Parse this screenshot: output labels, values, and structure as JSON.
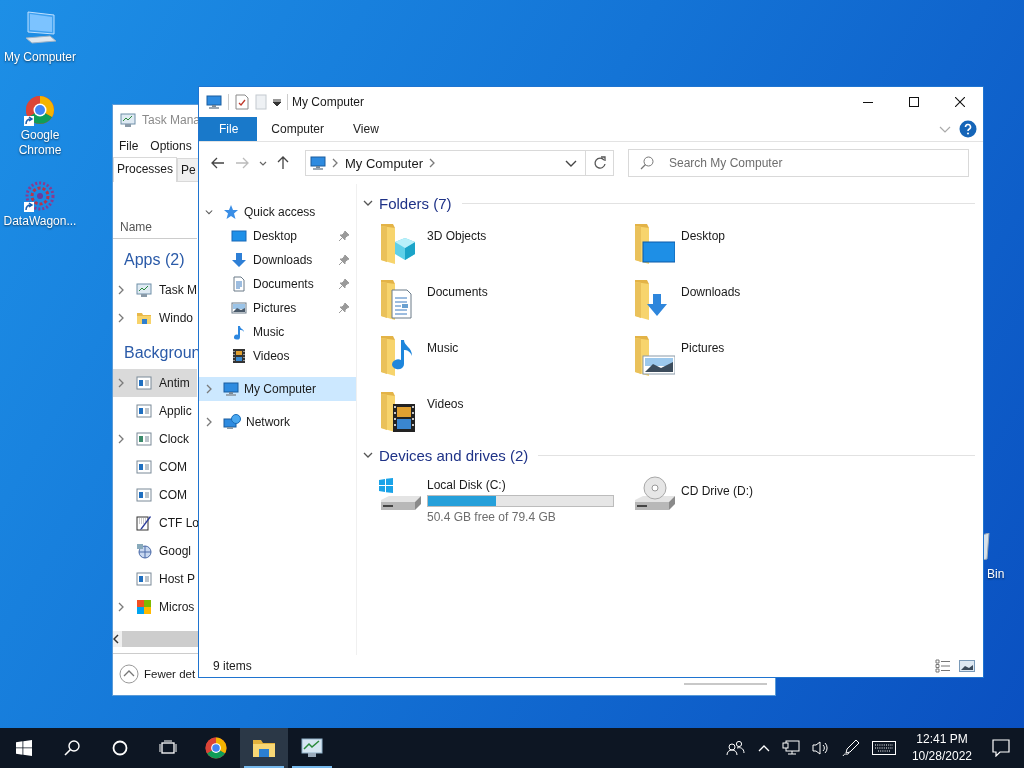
{
  "desktop": {
    "icons": [
      {
        "label": "My Computer"
      },
      {
        "label": "Google Chrome"
      },
      {
        "label": "DataWagon..."
      },
      {
        "label": "Bin"
      }
    ]
  },
  "task_manager": {
    "title": "Task Mana",
    "menu": [
      "File",
      "Options"
    ],
    "tabs": [
      {
        "label": "Processes",
        "selected": true
      },
      {
        "label": "Pe",
        "selected": false
      }
    ],
    "column": "Name",
    "groups": [
      {
        "label": "Apps (2)",
        "rows": [
          {
            "name": "Task M",
            "expandable": true,
            "selected": false
          },
          {
            "name": "Windo",
            "expandable": true,
            "selected": false
          }
        ]
      },
      {
        "label": "Backgroun",
        "rows": [
          {
            "name": "Antim",
            "expandable": true,
            "selected": true
          },
          {
            "name": "Applic",
            "expandable": false,
            "selected": false
          },
          {
            "name": "Clock",
            "expandable": true,
            "selected": false
          },
          {
            "name": "COM",
            "expandable": false,
            "selected": false
          },
          {
            "name": "COM",
            "expandable": false,
            "selected": false
          },
          {
            "name": "CTF Lo",
            "expandable": false,
            "selected": false
          },
          {
            "name": "Googl",
            "expandable": false,
            "selected": false
          },
          {
            "name": "Host P",
            "expandable": false,
            "selected": false
          },
          {
            "name": "Micros",
            "expandable": true,
            "selected": false
          }
        ]
      }
    ],
    "footer": "Fewer det"
  },
  "explorer": {
    "title": "My Computer",
    "ribbon_tabs": [
      {
        "label": "File",
        "selected": true
      },
      {
        "label": "Computer",
        "selected": false
      },
      {
        "label": "View",
        "selected": false
      }
    ],
    "address": "My Computer",
    "search": {
      "placeholder": "Search My Computer"
    },
    "navigation": [
      {
        "label": "Quick access",
        "expanded": true,
        "selected": false,
        "children": [
          {
            "label": "Desktop",
            "pinned": true,
            "selected": false
          },
          {
            "label": "Downloads",
            "pinned": true,
            "selected": false
          },
          {
            "label": "Documents",
            "pinned": true,
            "selected": false
          },
          {
            "label": "Pictures",
            "pinned": true,
            "selected": false
          },
          {
            "label": "Music",
            "pinned": false,
            "selected": false
          },
          {
            "label": "Videos",
            "pinned": false,
            "selected": false
          }
        ]
      },
      {
        "label": "My Computer",
        "expanded": false,
        "selected": true
      },
      {
        "label": "Network",
        "expanded": false,
        "selected": false
      }
    ],
    "groups": [
      {
        "label": "Folders (7)",
        "expanded": true,
        "kind": "folders",
        "items": [
          {
            "label": "3D Objects"
          },
          {
            "label": "Desktop"
          },
          {
            "label": "Documents"
          },
          {
            "label": "Downloads"
          },
          {
            "label": "Music"
          },
          {
            "label": "Pictures"
          },
          {
            "label": "Videos"
          }
        ]
      },
      {
        "label": "Devices and drives (2)",
        "expanded": true,
        "kind": "drives",
        "items": [
          {
            "label": "Local Disk (C:)",
            "level": 0.37,
            "detail": "50.4 GB free of 79.4 GB"
          },
          {
            "label": "CD Drive (D:)"
          }
        ]
      }
    ],
    "status_bar": "9 items"
  },
  "taskbar": {
    "apps": [
      {
        "running": false,
        "active": false
      },
      {
        "running": true,
        "active": true
      },
      {
        "running": true,
        "active": false
      }
    ],
    "clock": {
      "time": "12:41 PM",
      "date": "10/28/2022"
    }
  }
}
